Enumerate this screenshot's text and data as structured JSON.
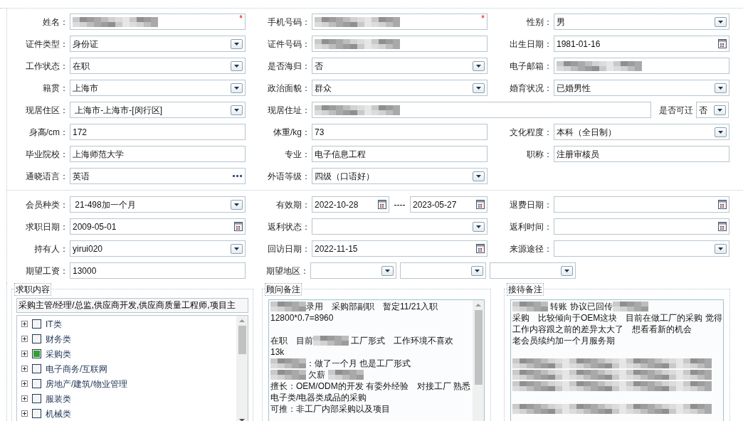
{
  "profile": {
    "rows": [
      [
        {
          "label": "姓名：",
          "kind": "text",
          "blurred": true,
          "required_mark": "*"
        },
        {
          "label": "手机号码：",
          "kind": "text",
          "blurred": true,
          "required_mark": "*"
        },
        {
          "label": "性别：",
          "kind": "select",
          "value": "男",
          "blurred": false
        }
      ],
      [
        {
          "label": "证件类型：",
          "kind": "select",
          "value": "身份证",
          "blurred": false
        },
        {
          "label": "证件号码：",
          "kind": "text",
          "blurred": true
        },
        {
          "label": "出生日期：",
          "kind": "date",
          "value": "1981-01-16",
          "blurred": false
        }
      ],
      [
        {
          "label": "工作状态：",
          "kind": "select",
          "value": "在职",
          "blurred": false
        },
        {
          "label": "是否海归：",
          "kind": "select",
          "value": "否",
          "blurred": false
        },
        {
          "label": "电子邮箱：",
          "kind": "text",
          "blurred": true
        }
      ],
      [
        {
          "label": "籍贯：",
          "kind": "select",
          "value": "上海市",
          "blurred": false
        },
        {
          "label": "政治面貌：",
          "kind": "select",
          "value": "群众",
          "blurred": false
        },
        {
          "label": "婚育状况：",
          "kind": "select",
          "value": "已婚男性",
          "blurred": false
        }
      ],
      [
        {
          "label": "现居住区：",
          "kind": "select",
          "value": " 上海市-上海市-[闵行区]",
          "blurred": false
        },
        {
          "label": "现居住址：",
          "kind": "wide",
          "blurred": true,
          "extra": {
            "label": "是否可迁",
            "value": "否"
          }
        }
      ],
      [
        {
          "label": "身高/cm：",
          "kind": "text",
          "value": "172",
          "blurred": false
        },
        {
          "label": "体重/kg：",
          "kind": "text",
          "value": "73",
          "blurred": false
        },
        {
          "label": "文化程度：",
          "kind": "select",
          "value": "本科（全日制）",
          "blurred": false
        }
      ],
      [
        {
          "label": "毕业院校：",
          "kind": "text",
          "value": "上海师范大学",
          "blurred": false
        },
        {
          "label": "专业：",
          "kind": "text",
          "value": "电子信息工程",
          "blurred": false
        },
        {
          "label": "职称：",
          "kind": "text",
          "value": "注册审核员",
          "blurred": false
        }
      ],
      [
        {
          "label": "通晓语言：",
          "kind": "lookup",
          "value": "英语",
          "blurred": false
        },
        {
          "label": "外语等级：",
          "kind": "select",
          "value": "四级（口语好）",
          "blurred": false
        }
      ]
    ]
  },
  "membership": {
    "rows": [
      [
        {
          "label": "会员种类：",
          "kind": "select",
          "value": " 21-498加一个月",
          "blurred": false
        },
        {
          "label": "有效期：",
          "kind": "range",
          "from": "2022-10-28",
          "separator": "----",
          "to": "2023-05-27"
        },
        {
          "label": "退费日期：",
          "kind": "date",
          "blurred": false
        }
      ],
      [
        {
          "label": "求职日期：",
          "kind": "date",
          "value": "2009-05-01",
          "blurred": false
        },
        {
          "label": "返利状态：",
          "kind": "select",
          "blurred": false
        },
        {
          "label": "返利时间：",
          "kind": "date",
          "blurred": false
        }
      ],
      [
        {
          "label": "持有人：",
          "kind": "select",
          "value": "yirui020",
          "blurred": false
        },
        {
          "label": "回访日期：",
          "kind": "date",
          "value": "2022-11-15",
          "blurred": false
        },
        {
          "label": "来源途径：",
          "kind": "select",
          "blurred": false
        }
      ],
      [
        {
          "label": "期望工资：",
          "kind": "text",
          "value": "13000",
          "blurred": false
        },
        {
          "label": "期望地区：",
          "kind": "cascade",
          "parts": [
            {
              "kind": "select"
            },
            {
              "kind": "select"
            },
            {
              "kind": "select"
            }
          ]
        }
      ]
    ]
  },
  "job_intent": {
    "title": "求职内容",
    "summary": "采购主管/经理/总监,供应商开发,供应商质量工程师,项目主",
    "categories": [
      {
        "label": "IT类",
        "checked": false,
        "expanded": false
      },
      {
        "label": "财务类",
        "checked": false,
        "expanded": false
      },
      {
        "label": "采购类",
        "checked": true,
        "expanded": false
      },
      {
        "label": "电子商务/互联网",
        "checked": false,
        "expanded": false
      },
      {
        "label": "房地产/建筑/物业管理",
        "checked": false,
        "expanded": false
      },
      {
        "label": "服装类",
        "checked": false,
        "expanded": false
      },
      {
        "label": "机械类",
        "checked": false,
        "expanded": false
      }
    ]
  },
  "consultant_notes": {
    "title": "顾问备注",
    "lines": [
      {
        "kind": "text",
        "parts": [
          {
            "kind": "blur"
          },
          {
            "kind": "text",
            "text": "录用　采购部副职　暂定11/21入职"
          }
        ]
      },
      {
        "kind": "text",
        "parts": [
          {
            "kind": "text",
            "text": "12800*0.7=8960"
          }
        ]
      },
      {
        "kind": "blank"
      },
      {
        "kind": "text",
        "parts": [
          {
            "kind": "text",
            "text": "在职　目前"
          },
          {
            "kind": "blur"
          },
          {
            "kind": "text",
            "text": " 工厂形式　工作环境不喜欢"
          }
        ]
      },
      {
        "kind": "text",
        "parts": [
          {
            "kind": "text",
            "text": "13k"
          }
        ]
      },
      {
        "kind": "text",
        "parts": [
          {
            "kind": "blur"
          },
          {
            "kind": "text",
            "text": "：做了一个月 也是工厂形式"
          }
        ]
      },
      {
        "kind": "text",
        "parts": [
          {
            "kind": "blur"
          },
          {
            "kind": "text",
            "text": " 欠薪 "
          },
          {
            "kind": "blur"
          }
        ]
      },
      {
        "kind": "text",
        "parts": [
          {
            "kind": "text",
            "text": "擅长：OEM/ODM的开发 有委外经验　对接工厂 熟悉"
          }
        ]
      },
      {
        "kind": "text",
        "parts": [
          {
            "kind": "text",
            "text": "电子类/电器类成品的采购"
          }
        ]
      },
      {
        "kind": "text",
        "parts": [
          {
            "kind": "text",
            "text": "可推：非工厂内部采购以及项目"
          }
        ]
      }
    ]
  },
  "reception_notes": {
    "title": "接待备注",
    "lines": [
      {
        "kind": "text",
        "parts": [
          {
            "kind": "blur"
          },
          {
            "kind": "text",
            "text": " 转账 协议已回传"
          },
          {
            "kind": "blur"
          }
        ]
      },
      {
        "kind": "text",
        "parts": [
          {
            "kind": "text",
            "text": "采购　比较倾向于OEM这块　目前在做工厂的采购 觉得"
          }
        ]
      },
      {
        "kind": "text",
        "parts": [
          {
            "kind": "text",
            "text": "工作内容跟之前的差异太大了　想看看新的机会"
          }
        ]
      },
      {
        "kind": "text",
        "parts": [
          {
            "kind": "text",
            "text": "老会员续约加一个月服务期"
          }
        ]
      },
      {
        "kind": "blank"
      },
      {
        "kind": "blurred"
      },
      {
        "kind": "blurred"
      },
      {
        "kind": "blurred"
      },
      {
        "kind": "blank"
      },
      {
        "kind": "blurred"
      }
    ]
  }
}
